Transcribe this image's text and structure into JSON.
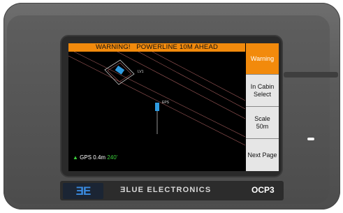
{
  "warning_banner": "WARNING!   POWERLINE 10M AHEAD",
  "side_buttons": [
    {
      "label": "Warning",
      "active": true
    },
    {
      "label": "In Cabin\nSelect",
      "active": false
    },
    {
      "label": "Scale\n50m",
      "active": false
    },
    {
      "label": "Next Page",
      "active": false
    }
  ],
  "map": {
    "lv1_label": "LV1",
    "eps_label": "EPS"
  },
  "gps": {
    "prefix": "GPS",
    "accuracy": "0.4m",
    "heading": "240'"
  },
  "brand": {
    "logo_text": "ƎE",
    "name": "ƎLUE ELECTRONICS",
    "model": "OCP3"
  },
  "colors": {
    "warning": "#f28a0c",
    "button": "#e6e6e6",
    "gps_green": "#3ccf3c",
    "marker_blue": "#2f9be0"
  }
}
